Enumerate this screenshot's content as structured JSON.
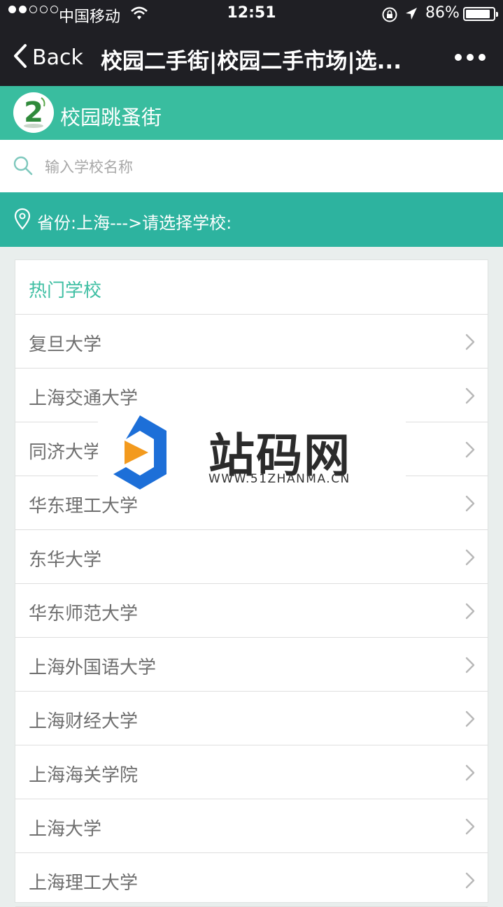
{
  "status_bar": {
    "carrier": "中国移动",
    "time": "12:51",
    "battery": "86%",
    "battery_level": 0.86
  },
  "nav": {
    "back_label": "Back",
    "title": "校园二手街|校园二手市场|选..."
  },
  "app": {
    "title": "校园跳蚤街",
    "accent_color": "#39bd9f"
  },
  "search": {
    "placeholder": "输入学校名称",
    "value": ""
  },
  "province": {
    "text": "省份:上海--->请选择学校:"
  },
  "schools": {
    "header": "热门学校",
    "items": [
      {
        "name": "复旦大学"
      },
      {
        "name": "上海交通大学"
      },
      {
        "name": "同济大学"
      },
      {
        "name": "华东理工大学"
      },
      {
        "name": "东华大学"
      },
      {
        "name": "华东师范大学"
      },
      {
        "name": "上海外国语大学"
      },
      {
        "name": "上海财经大学"
      },
      {
        "name": "上海海关学院"
      },
      {
        "name": "上海大学"
      },
      {
        "name": "上海理工大学"
      }
    ]
  },
  "watermark": {
    "name": "站码网",
    "url": "WWW.51ZHANMA.CN"
  }
}
